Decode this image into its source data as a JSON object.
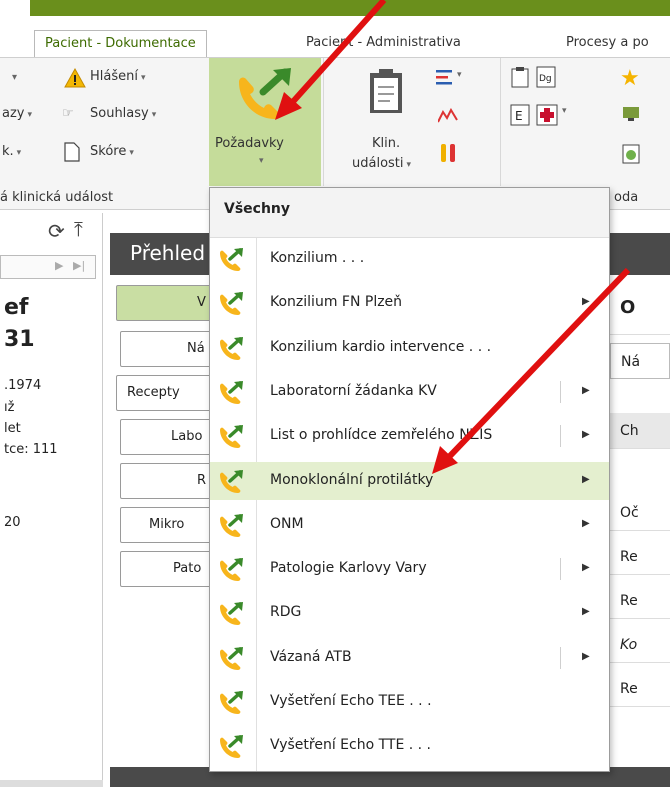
{
  "tabs": [
    {
      "label": "Pacient - Dokumentace",
      "active": true
    },
    {
      "label": "Pacient - Administrativa",
      "active": false
    },
    {
      "label": "Procesy a po",
      "active": false
    }
  ],
  "ribbon": {
    "hlaseni_label": "Hlášení",
    "souhlasy_label": "Souhlasy",
    "skore_label": "Skóre",
    "zazy_label": "azy",
    "k_label": "k.",
    "pozadavky_label": "Požadavky",
    "klin_label_line1": "Klin.",
    "klin_label_line2": "události",
    "group_label_left": "á klinická událost",
    "group_label_right": "oda"
  },
  "left_panel": {
    "lines": [
      "ef",
      "31",
      ".1974",
      "ıž",
      "let",
      "tce: 111",
      "20"
    ]
  },
  "overview": {
    "title": "Přehled",
    "left_buttons": [
      "V",
      "Ná",
      "Recepty",
      "Labo",
      "R",
      "Mikro",
      "Pato"
    ],
    "right_header_letter": "O",
    "right_cells": [
      "Ná",
      "Ch",
      "Oč",
      "Re",
      "Re",
      "Ko",
      "Re"
    ]
  },
  "menu": {
    "title": "Všechny",
    "items": [
      {
        "label": "Konzilium . . .",
        "submenu": false,
        "split": false
      },
      {
        "label": "Konzilium FN Plzeň",
        "submenu": true,
        "split": false
      },
      {
        "label": "Konzilium kardio intervence . . .",
        "submenu": false,
        "split": false
      },
      {
        "label": "Laboratorní žádanka KV",
        "submenu": true,
        "split": true
      },
      {
        "label": "List o prohlídce zemřelého NZIS",
        "submenu": true,
        "split": true
      },
      {
        "label": "Monoklonální protilátky",
        "submenu": true,
        "split": false,
        "highlighted": true
      },
      {
        "label": "ONM",
        "submenu": true,
        "split": false
      },
      {
        "label": "Patologie Karlovy Vary",
        "submenu": true,
        "split": true
      },
      {
        "label": "RDG",
        "submenu": true,
        "split": false
      },
      {
        "label": "Vázaná ATB",
        "submenu": true,
        "split": true
      },
      {
        "label": "Vyšetření Echo TEE . . .",
        "submenu": false,
        "split": false
      },
      {
        "label": "Vyšetření Echo TTE . . .",
        "submenu": false,
        "split": false
      }
    ]
  },
  "colors": {
    "accent_green": "#6a8f1c",
    "highlight": "#e4efcf",
    "pozadavky_bg": "#c5dc9a",
    "annotation_arrow": "#e01010"
  }
}
